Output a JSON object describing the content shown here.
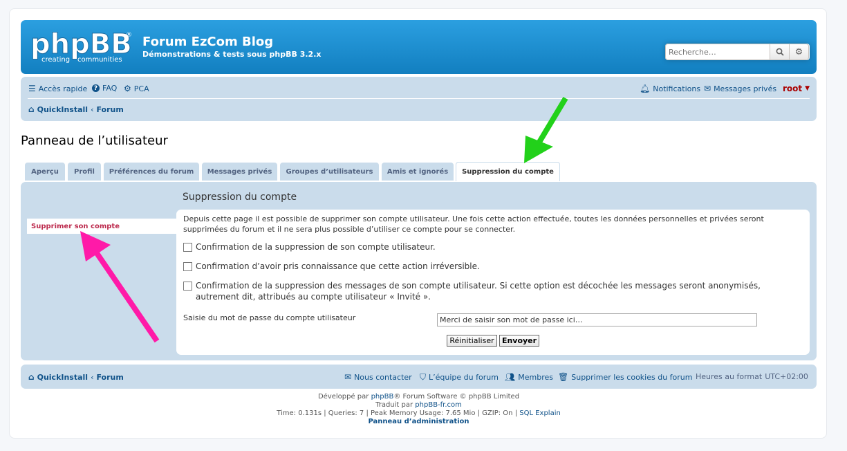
{
  "header": {
    "logo_main": "phpBB",
    "logo_tag1": "creating",
    "logo_tag2": "communities",
    "site_title": "Forum EzCom Blog",
    "site_description": "Démonstrations & tests sous phpBB 3.2.x",
    "search_placeholder": "Recherche…"
  },
  "navbar": {
    "quick_access": "Accès rapide",
    "faq": "FAQ",
    "pca": "PCA",
    "notifications": "Notifications",
    "private_messages": "Messages privés",
    "username": "root",
    "breadcrumb_home": "QuickInstall",
    "breadcrumb_sep": "‹",
    "breadcrumb_forum": "Forum"
  },
  "page_title": "Panneau de l’utilisateur",
  "tabs": [
    {
      "label": "Aperçu"
    },
    {
      "label": "Profil"
    },
    {
      "label": "Préférences du forum"
    },
    {
      "label": "Messages privés"
    },
    {
      "label": "Groupes d’utilisateurs"
    },
    {
      "label": "Amis et ignorés"
    },
    {
      "label": "Suppression du compte",
      "active": true
    }
  ],
  "sidebar": {
    "item": "Supprimer son compte"
  },
  "content": {
    "title": "Suppression du compte",
    "description": "Depuis cette page il est possible de supprimer son compte utilisateur. Une fois cette action effectuée, toutes les données personnelles et privées seront supprimées du forum et il ne sera plus possible d’utiliser ce compte pour se connecter.",
    "checkbox1": "Confirmation de la suppression de son compte utilisateur.",
    "checkbox2": "Confirmation d’avoir pris connaissance que cette action irréversible.",
    "checkbox3": "Confirmation de la suppression des messages de son compte utilisateur. Si cette option est décochée les messages seront anonymisés, autrement dit, attribués au compte utilisateur « Invité ».",
    "password_label": "Saisie du mot de passe du compte utilisateur",
    "password_placeholder": "Merci de saisir son mot de passe ici…",
    "reset_button": "Réinitialiser",
    "submit_button": "Envoyer"
  },
  "footer_nav": {
    "breadcrumb_home": "QuickInstall",
    "breadcrumb_sep": "‹",
    "breadcrumb_forum": "Forum",
    "contact": "Nous contacter",
    "team": "L’équipe du forum",
    "members": "Membres",
    "delete_cookies": "Supprimer les cookies du forum",
    "timezone_label": "Heures au format",
    "timezone": "UTC+02:00"
  },
  "copyright": {
    "line1_prefix": "Développé par",
    "line1_link": "phpBB",
    "line1_suffix": "® Forum Software © phpBB Limited",
    "line2_prefix": "Traduit par",
    "line2_link": "phpBB-fr.com",
    "line3_prefix": "Time: 0.131s | Queries: 7 | Peak Memory Usage: 7.65 Mio | GZIP: On |",
    "line3_link": "SQL Explain",
    "admin_link": "Panneau d’administration"
  },
  "colors": {
    "header_blue": "#1a8fd0",
    "nav_bg": "#cadceb",
    "link": "#105289",
    "sidebar_active": "#bc2a4d",
    "arrow_green": "#22d11a",
    "arrow_pink": "#ff1aa8"
  }
}
